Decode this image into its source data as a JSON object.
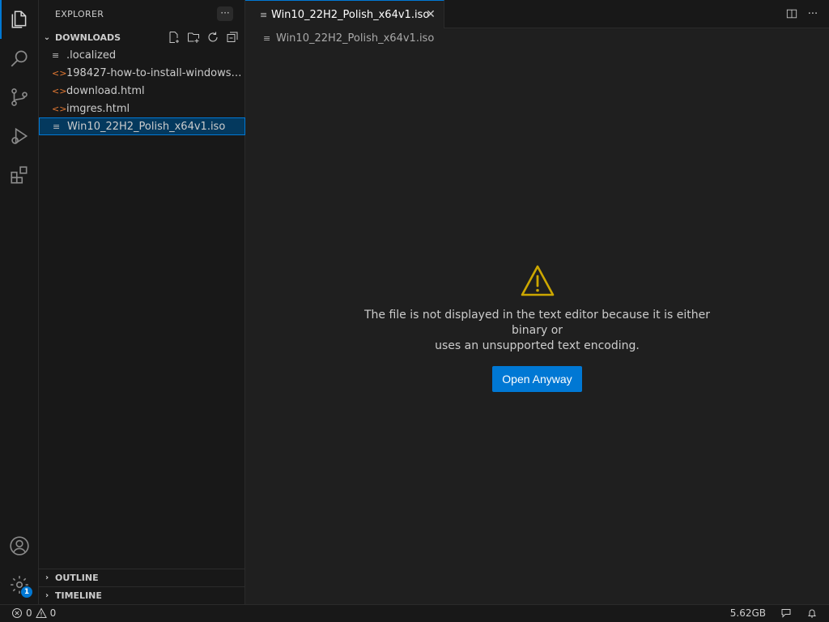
{
  "sidebar": {
    "title": "EXPLORER",
    "more_label": "···",
    "section": "DOWNLOADS",
    "files": [
      {
        "name": ".localized",
        "icon": "text-file-icon",
        "glyph": "≡"
      },
      {
        "name": "198427-how-to-install-windows-1...",
        "icon": "html-file-icon",
        "glyph": "<>"
      },
      {
        "name": "download.html",
        "icon": "html-file-icon",
        "glyph": "<>"
      },
      {
        "name": "imgres.html",
        "icon": "html-file-icon",
        "glyph": "<>"
      },
      {
        "name": "Win10_22H2_Polish_x64v1.iso",
        "icon": "text-file-icon",
        "glyph": "≡"
      }
    ],
    "outline": "OUTLINE",
    "timeline": "TIMELINE"
  },
  "editor": {
    "tab_label": "Win10_22H2_Polish_x64v1.iso",
    "breadcrumb": "Win10_22H2_Polish_x64v1.iso",
    "message_line1": "The file is not displayed in the text editor because it is either binary or",
    "message_line2": "uses an unsupported text encoding.",
    "open_button": "Open Anyway"
  },
  "status": {
    "errors": "0",
    "warnings": "0",
    "memory": "5.62GB"
  },
  "activity": {
    "settings_badge": "1"
  },
  "colors": {
    "accent": "#0078d4",
    "warning": "#cca700",
    "html_icon": "#e37933"
  }
}
